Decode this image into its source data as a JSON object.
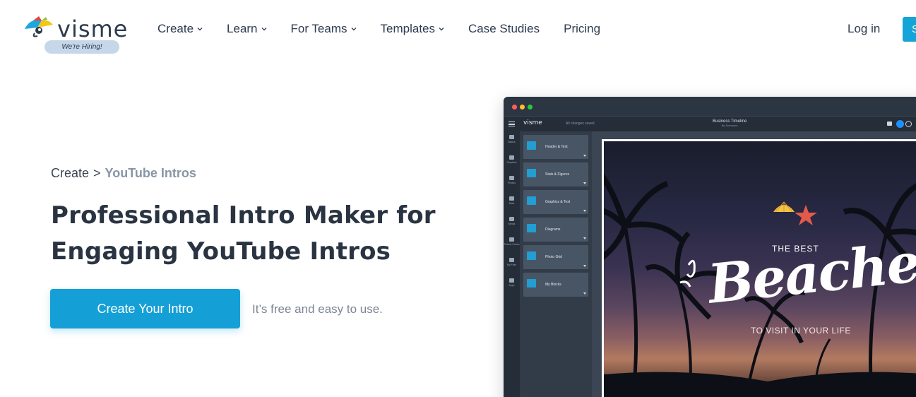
{
  "header": {
    "logo_text": "visme",
    "hiring_badge": "We're Hiring!",
    "nav": [
      {
        "label": "Create",
        "has_dropdown": true
      },
      {
        "label": "Learn",
        "has_dropdown": true
      },
      {
        "label": "For Teams",
        "has_dropdown": true
      },
      {
        "label": "Templates",
        "has_dropdown": true
      },
      {
        "label": "Case Studies",
        "has_dropdown": false
      },
      {
        "label": "Pricing",
        "has_dropdown": false
      }
    ],
    "login_label": "Log in",
    "signup_label": "S",
    "accent_color": "#14a4d8"
  },
  "hero": {
    "breadcrumb": {
      "root": "Create",
      "separator": ">",
      "current": "YouTube Intros"
    },
    "headline_line1": "Professional Intro Maker for",
    "headline_line2": "Engaging YouTube Intros",
    "cta_label": "Create Your Intro",
    "cta_note": "It’s free and easy to use."
  },
  "mockup": {
    "window_dots": [
      "#ff5f56",
      "#ffbd2e",
      "#27c93f"
    ],
    "app_logo": "visme",
    "saved_status": "All changes saved",
    "doc_title": "Business Timeline",
    "doc_owner": "By Someone",
    "rail": [
      {
        "label": "Basics",
        "icon": "shapes-icon"
      },
      {
        "label": "Graphics",
        "icon": "graphics-icon"
      },
      {
        "label": "Photos",
        "icon": "photo-icon"
      },
      {
        "label": "Data",
        "icon": "chart-icon"
      },
      {
        "label": "Media",
        "icon": "media-icon"
      },
      {
        "label": "Theme Colors",
        "icon": "palette-icon"
      },
      {
        "label": "My Files",
        "icon": "files-icon"
      },
      {
        "label": "Apps",
        "icon": "apps-icon"
      }
    ],
    "blocks": [
      {
        "label": "Header & Text"
      },
      {
        "label": "Stats & Figures"
      },
      {
        "label": "Graphics & Text"
      },
      {
        "label": "Diagrams"
      },
      {
        "label": "Photo Grid"
      },
      {
        "label": "My Blocks"
      }
    ],
    "canvas": {
      "top_text": "THE BEST",
      "script_text": "Beaches",
      "bottom_text": "TO VISIT IN YOUR LIFE"
    }
  }
}
